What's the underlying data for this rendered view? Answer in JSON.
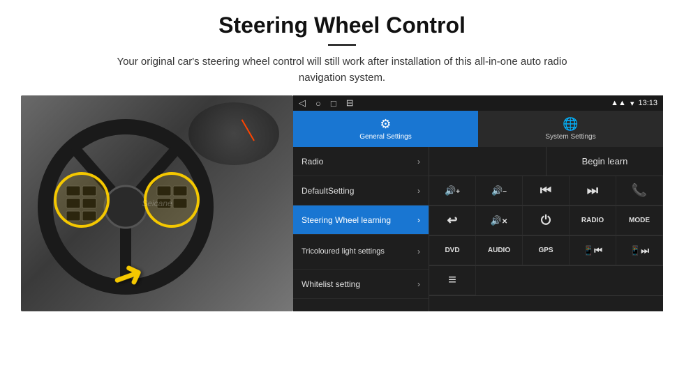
{
  "header": {
    "title": "Steering Wheel Control",
    "subtitle": "Your original car's steering wheel control will still work after installation of this all-in-one auto radio navigation system."
  },
  "android_ui": {
    "status_bar": {
      "time": "13:13",
      "nav_icons": [
        "◁",
        "○",
        "□",
        "⊟"
      ]
    },
    "tabs": [
      {
        "label": "General Settings",
        "active": true,
        "icon": "⚙"
      },
      {
        "label": "System Settings",
        "active": false,
        "icon": "🌐"
      }
    ],
    "left_menu": [
      {
        "label": "Radio",
        "active": false
      },
      {
        "label": "DefaultSetting",
        "active": false
      },
      {
        "label": "Steering Wheel learning",
        "active": true
      },
      {
        "label": "Tricoloured light settings",
        "active": false
      },
      {
        "label": "Whitelist setting",
        "active": false
      }
    ],
    "right_panel": {
      "begin_learn": "Begin learn",
      "control_row1": [
        {
          "icon": "🔊+",
          "label": ""
        },
        {
          "icon": "🔊−",
          "label": ""
        },
        {
          "icon": "⏮",
          "label": ""
        },
        {
          "icon": "⏭",
          "label": ""
        },
        {
          "icon": "📞",
          "label": ""
        }
      ],
      "control_row2": [
        {
          "icon": "↩",
          "label": ""
        },
        {
          "icon": "🔇",
          "label": ""
        },
        {
          "icon": "⏻",
          "label": ""
        },
        {
          "text": "RADIO",
          "label": ""
        },
        {
          "text": "MODE",
          "label": ""
        }
      ],
      "control_row3": [
        {
          "text": "DVD",
          "label": ""
        },
        {
          "text": "AUDIO",
          "label": ""
        },
        {
          "text": "GPS",
          "label": ""
        },
        {
          "icon": "📱⏮",
          "label": ""
        },
        {
          "icon": "📱⏭",
          "label": ""
        }
      ],
      "control_row4": [
        {
          "icon": "≡",
          "label": ""
        }
      ]
    }
  },
  "watermark": "Seicane",
  "arrow_symbol": "➜",
  "highlight_circles": [
    "left-controls",
    "right-controls"
  ]
}
